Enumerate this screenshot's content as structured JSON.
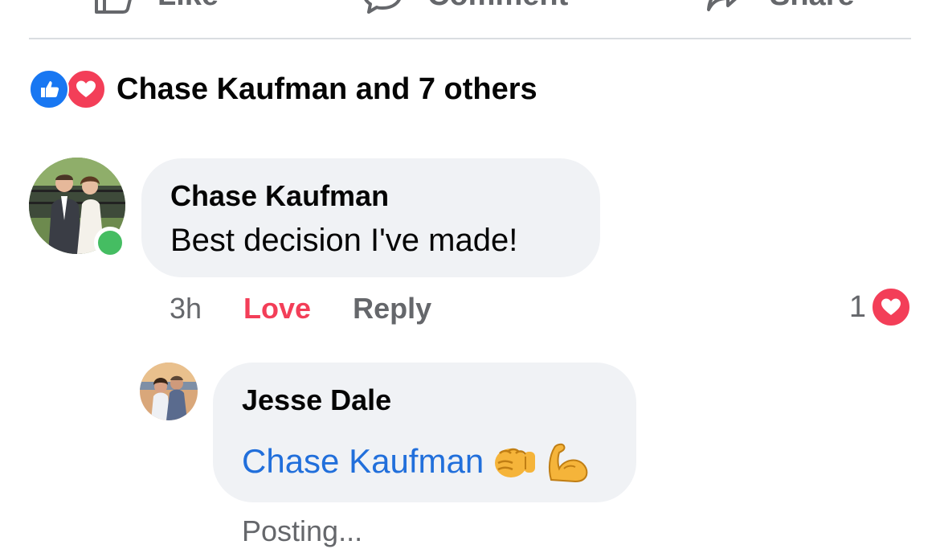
{
  "actions": {
    "like_label": "Like",
    "comment_label": "Comment",
    "share_label": "Share"
  },
  "reactions_summary": {
    "icons": [
      "like-icon",
      "love-icon"
    ],
    "text": "Chase Kaufman and 7 others"
  },
  "comments": [
    {
      "author": "Chase Kaufman",
      "text": "Best decision I've made!",
      "online": true,
      "time": "3h",
      "reaction_label": "Love",
      "reply_label": "Reply",
      "reaction_count": "1",
      "reaction_icon": "love-icon"
    }
  ],
  "reply": {
    "author": "Jesse Dale",
    "mention": "Chase Kaufman",
    "emojis": [
      "oncoming-fist-emoji",
      "flexed-biceps-emoji"
    ],
    "status": "Posting..."
  },
  "colors": {
    "like_blue": "#1877f2",
    "love_red": "#f33e58",
    "mention_blue": "#216fdb",
    "online_green": "#45bd62",
    "bubble_bg": "#f0f2f5",
    "secondary_text": "#65676b"
  }
}
